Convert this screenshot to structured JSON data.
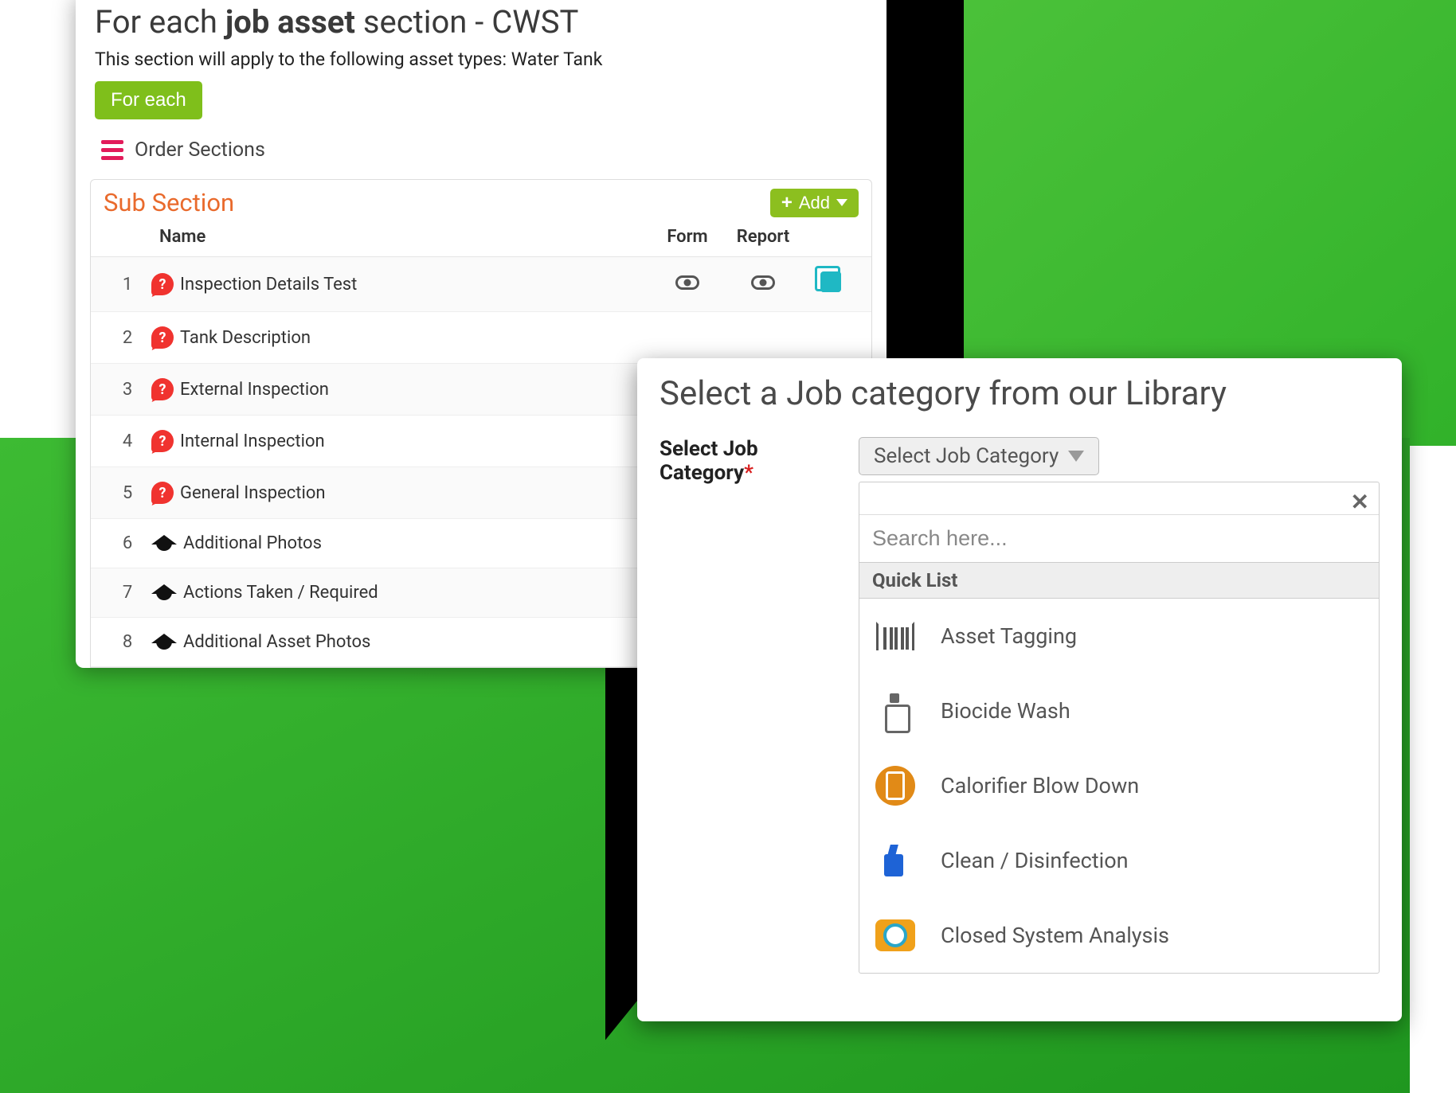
{
  "left": {
    "title_prefix": "For each ",
    "title_bold": "job asset",
    "title_suffix": " section - CWST",
    "subtitle": "This section will apply to the following asset types: Water Tank",
    "for_each_btn": "For each",
    "order_sections": "Order Sections",
    "sub_section_label": "Sub Section",
    "add_btn": "Add",
    "columns": {
      "name": "Name",
      "form": "Form",
      "report": "Report"
    },
    "rows": [
      {
        "n": "1",
        "name": "Inspection Details Test",
        "icon": "q",
        "form": true,
        "report": true,
        "copy": true
      },
      {
        "n": "2",
        "name": "Tank Description",
        "icon": "q"
      },
      {
        "n": "3",
        "name": "External Inspection",
        "icon": "q"
      },
      {
        "n": "4",
        "name": "Internal Inspection",
        "icon": "q"
      },
      {
        "n": "5",
        "name": "General Inspection",
        "icon": "q"
      },
      {
        "n": "6",
        "name": "Additional Photos",
        "icon": "grad"
      },
      {
        "n": "7",
        "name": "Actions Taken / Required",
        "icon": "grad"
      },
      {
        "n": "8",
        "name": "Additional Asset Photos",
        "icon": "grad"
      }
    ]
  },
  "right": {
    "title": "Select a Job category from our Library",
    "field_label": "Select Job Category",
    "select_placeholder": "Select Job Category",
    "search_placeholder": "Search here...",
    "quicklist_label": "Quick List",
    "items": [
      {
        "label": "Asset Tagging",
        "icon": "barcode"
      },
      {
        "label": "Biocide Wash",
        "icon": "spray"
      },
      {
        "label": "Calorifier Blow Down",
        "icon": "calor"
      },
      {
        "label": "Clean / Disinfection",
        "icon": "clean"
      },
      {
        "label": "Closed System Analysis",
        "icon": "closed"
      }
    ]
  }
}
